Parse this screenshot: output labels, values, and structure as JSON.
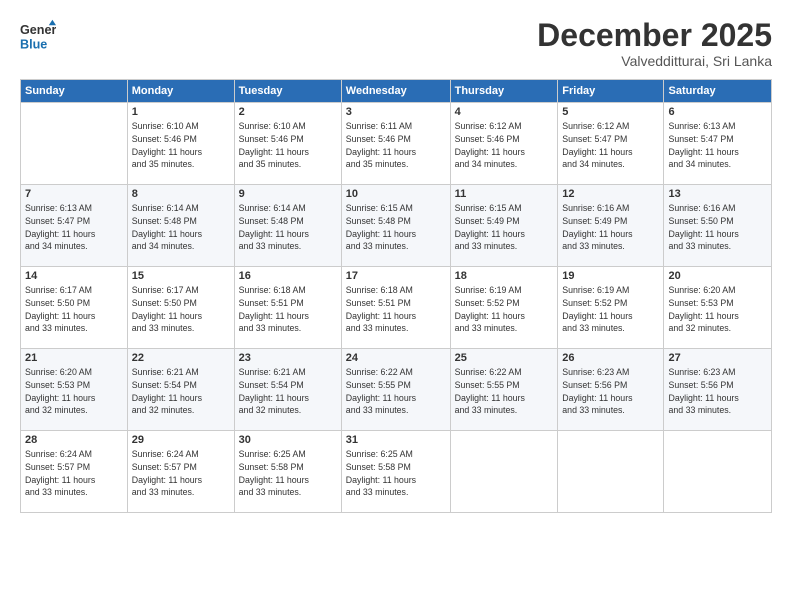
{
  "logo": {
    "line1": "General",
    "line2": "Blue"
  },
  "header": {
    "month": "December 2025",
    "location": "Valvedditturai, Sri Lanka"
  },
  "days_of_week": [
    "Sunday",
    "Monday",
    "Tuesday",
    "Wednesday",
    "Thursday",
    "Friday",
    "Saturday"
  ],
  "weeks": [
    [
      {
        "day": "",
        "sunrise": "",
        "sunset": "",
        "daylight": ""
      },
      {
        "day": "1",
        "sunrise": "Sunrise: 6:10 AM",
        "sunset": "Sunset: 5:46 PM",
        "daylight": "Daylight: 11 hours and 35 minutes."
      },
      {
        "day": "2",
        "sunrise": "Sunrise: 6:10 AM",
        "sunset": "Sunset: 5:46 PM",
        "daylight": "Daylight: 11 hours and 35 minutes."
      },
      {
        "day": "3",
        "sunrise": "Sunrise: 6:11 AM",
        "sunset": "Sunset: 5:46 PM",
        "daylight": "Daylight: 11 hours and 35 minutes."
      },
      {
        "day": "4",
        "sunrise": "Sunrise: 6:12 AM",
        "sunset": "Sunset: 5:46 PM",
        "daylight": "Daylight: 11 hours and 34 minutes."
      },
      {
        "day": "5",
        "sunrise": "Sunrise: 6:12 AM",
        "sunset": "Sunset: 5:47 PM",
        "daylight": "Daylight: 11 hours and 34 minutes."
      },
      {
        "day": "6",
        "sunrise": "Sunrise: 6:13 AM",
        "sunset": "Sunset: 5:47 PM",
        "daylight": "Daylight: 11 hours and 34 minutes."
      }
    ],
    [
      {
        "day": "7",
        "sunrise": "Sunrise: 6:13 AM",
        "sunset": "Sunset: 5:47 PM",
        "daylight": "Daylight: 11 hours and 34 minutes."
      },
      {
        "day": "8",
        "sunrise": "Sunrise: 6:14 AM",
        "sunset": "Sunset: 5:48 PM",
        "daylight": "Daylight: 11 hours and 34 minutes."
      },
      {
        "day": "9",
        "sunrise": "Sunrise: 6:14 AM",
        "sunset": "Sunset: 5:48 PM",
        "daylight": "Daylight: 11 hours and 33 minutes."
      },
      {
        "day": "10",
        "sunrise": "Sunrise: 6:15 AM",
        "sunset": "Sunset: 5:48 PM",
        "daylight": "Daylight: 11 hours and 33 minutes."
      },
      {
        "day": "11",
        "sunrise": "Sunrise: 6:15 AM",
        "sunset": "Sunset: 5:49 PM",
        "daylight": "Daylight: 11 hours and 33 minutes."
      },
      {
        "day": "12",
        "sunrise": "Sunrise: 6:16 AM",
        "sunset": "Sunset: 5:49 PM",
        "daylight": "Daylight: 11 hours and 33 minutes."
      },
      {
        "day": "13",
        "sunrise": "Sunrise: 6:16 AM",
        "sunset": "Sunset: 5:50 PM",
        "daylight": "Daylight: 11 hours and 33 minutes."
      }
    ],
    [
      {
        "day": "14",
        "sunrise": "Sunrise: 6:17 AM",
        "sunset": "Sunset: 5:50 PM",
        "daylight": "Daylight: 11 hours and 33 minutes."
      },
      {
        "day": "15",
        "sunrise": "Sunrise: 6:17 AM",
        "sunset": "Sunset: 5:50 PM",
        "daylight": "Daylight: 11 hours and 33 minutes."
      },
      {
        "day": "16",
        "sunrise": "Sunrise: 6:18 AM",
        "sunset": "Sunset: 5:51 PM",
        "daylight": "Daylight: 11 hours and 33 minutes."
      },
      {
        "day": "17",
        "sunrise": "Sunrise: 6:18 AM",
        "sunset": "Sunset: 5:51 PM",
        "daylight": "Daylight: 11 hours and 33 minutes."
      },
      {
        "day": "18",
        "sunrise": "Sunrise: 6:19 AM",
        "sunset": "Sunset: 5:52 PM",
        "daylight": "Daylight: 11 hours and 33 minutes."
      },
      {
        "day": "19",
        "sunrise": "Sunrise: 6:19 AM",
        "sunset": "Sunset: 5:52 PM",
        "daylight": "Daylight: 11 hours and 33 minutes."
      },
      {
        "day": "20",
        "sunrise": "Sunrise: 6:20 AM",
        "sunset": "Sunset: 5:53 PM",
        "daylight": "Daylight: 11 hours and 32 minutes."
      }
    ],
    [
      {
        "day": "21",
        "sunrise": "Sunrise: 6:20 AM",
        "sunset": "Sunset: 5:53 PM",
        "daylight": "Daylight: 11 hours and 32 minutes."
      },
      {
        "day": "22",
        "sunrise": "Sunrise: 6:21 AM",
        "sunset": "Sunset: 5:54 PM",
        "daylight": "Daylight: 11 hours and 32 minutes."
      },
      {
        "day": "23",
        "sunrise": "Sunrise: 6:21 AM",
        "sunset": "Sunset: 5:54 PM",
        "daylight": "Daylight: 11 hours and 32 minutes."
      },
      {
        "day": "24",
        "sunrise": "Sunrise: 6:22 AM",
        "sunset": "Sunset: 5:55 PM",
        "daylight": "Daylight: 11 hours and 33 minutes."
      },
      {
        "day": "25",
        "sunrise": "Sunrise: 6:22 AM",
        "sunset": "Sunset: 5:55 PM",
        "daylight": "Daylight: 11 hours and 33 minutes."
      },
      {
        "day": "26",
        "sunrise": "Sunrise: 6:23 AM",
        "sunset": "Sunset: 5:56 PM",
        "daylight": "Daylight: 11 hours and 33 minutes."
      },
      {
        "day": "27",
        "sunrise": "Sunrise: 6:23 AM",
        "sunset": "Sunset: 5:56 PM",
        "daylight": "Daylight: 11 hours and 33 minutes."
      }
    ],
    [
      {
        "day": "28",
        "sunrise": "Sunrise: 6:24 AM",
        "sunset": "Sunset: 5:57 PM",
        "daylight": "Daylight: 11 hours and 33 minutes."
      },
      {
        "day": "29",
        "sunrise": "Sunrise: 6:24 AM",
        "sunset": "Sunset: 5:57 PM",
        "daylight": "Daylight: 11 hours and 33 minutes."
      },
      {
        "day": "30",
        "sunrise": "Sunrise: 6:25 AM",
        "sunset": "Sunset: 5:58 PM",
        "daylight": "Daylight: 11 hours and 33 minutes."
      },
      {
        "day": "31",
        "sunrise": "Sunrise: 6:25 AM",
        "sunset": "Sunset: 5:58 PM",
        "daylight": "Daylight: 11 hours and 33 minutes."
      },
      {
        "day": "",
        "sunrise": "",
        "sunset": "",
        "daylight": ""
      },
      {
        "day": "",
        "sunrise": "",
        "sunset": "",
        "daylight": ""
      },
      {
        "day": "",
        "sunrise": "",
        "sunset": "",
        "daylight": ""
      }
    ]
  ]
}
